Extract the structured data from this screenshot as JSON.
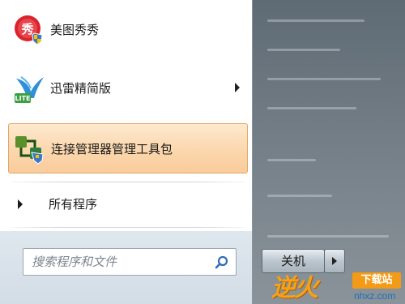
{
  "menu": {
    "items": [
      {
        "label": "美图秀秀",
        "icon": "meitu-icon",
        "has_submenu": false
      },
      {
        "label": "迅雷精简版",
        "icon": "xunlei-lite-icon",
        "has_submenu": true
      },
      {
        "label": "连接管理器管理工具包",
        "icon": "connection-manager-icon",
        "has_submenu": false,
        "highlighted": true
      }
    ],
    "all_programs": "所有程序"
  },
  "search": {
    "placeholder": "搜索程序和文件"
  },
  "shutdown": {
    "label": "关机"
  },
  "watermark": {
    "brand": "逆火",
    "tag": "下载站",
    "domain": "nhxz.com"
  },
  "colors": {
    "highlight": "#fbd7ad",
    "highlight_border": "#e3a768",
    "search_icon": "#2f6db5"
  }
}
